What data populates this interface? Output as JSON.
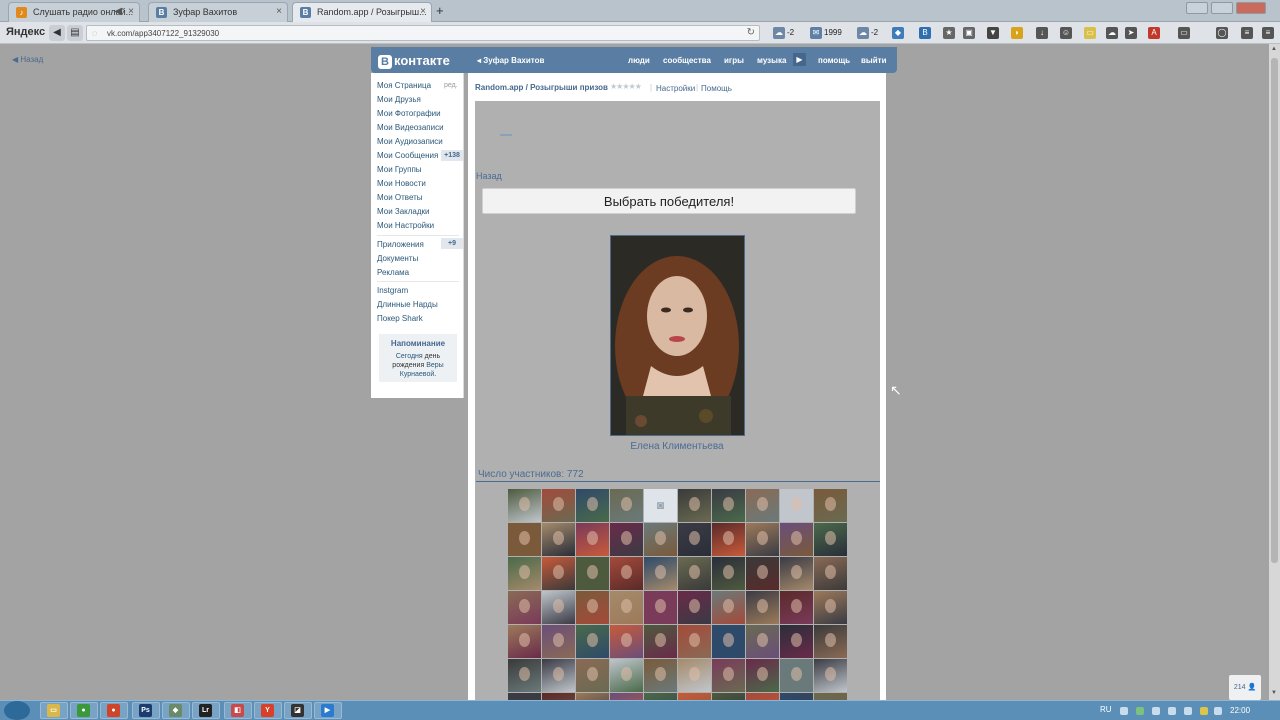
{
  "browser": {
    "tabs": [
      {
        "title": "Слушать радио онлай...",
        "icon": "radio-icon",
        "has_audio": true
      },
      {
        "title": "Зуфар Вахитов",
        "icon": "vk-icon"
      },
      {
        "title": "Random.app / Розыгрыш...",
        "icon": "vk-icon",
        "active": true
      }
    ],
    "new_tab": "+",
    "yandex_label": "Яндекс",
    "url": "vk.com/app3407122_91329030",
    "extensions": {
      "weather1": "-2",
      "mail_count": "1999",
      "weather2": "-2"
    }
  },
  "page": {
    "back_label": "Назад"
  },
  "vk": {
    "logo": "контакте",
    "logo_letter": "В",
    "user_name": "Зуфар Вахитов",
    "nav": [
      "люди",
      "сообщества",
      "игры",
      "музыка",
      "помощь",
      "выйти"
    ],
    "sidebar": {
      "edit_label": "ред.",
      "items": [
        {
          "label": "Моя Страница"
        },
        {
          "label": "Мои Друзья"
        },
        {
          "label": "Мои Фотографии"
        },
        {
          "label": "Мои Видеозаписи"
        },
        {
          "label": "Мои Аудиозаписи"
        },
        {
          "label": "Мои Сообщения",
          "count": "+138"
        },
        {
          "label": "Мои Группы"
        },
        {
          "label": "Мои Новости"
        },
        {
          "label": "Мои Ответы"
        },
        {
          "label": "Мои Закладки"
        },
        {
          "label": "Мои Настройки"
        }
      ],
      "apps": [
        {
          "label": "Приложения",
          "count": "+9"
        },
        {
          "label": "Документы"
        },
        {
          "label": "Реклама"
        }
      ],
      "extras": [
        {
          "label": "Instgram"
        },
        {
          "label": "Длинные Нарды"
        },
        {
          "label": "Покер Shark"
        }
      ],
      "reminder": {
        "title": "Напоминание",
        "text_today": "Сегодня",
        "text_mid": "день рождения",
        "link": "Веры Курнаевой",
        "dot": "."
      }
    },
    "app": {
      "breadcrumb": "Random.app / Розыгрыши призов",
      "settings": "Настройки",
      "help": "Помощь",
      "separator": "|",
      "back": "Назад",
      "winner_button": "Выбрать победителя!",
      "winner_name": "Елена Климентьева",
      "participants_label": "Число участников: 772"
    },
    "online_count": "214"
  },
  "taskbar": {
    "lang": "RU",
    "clock": "22:00"
  }
}
